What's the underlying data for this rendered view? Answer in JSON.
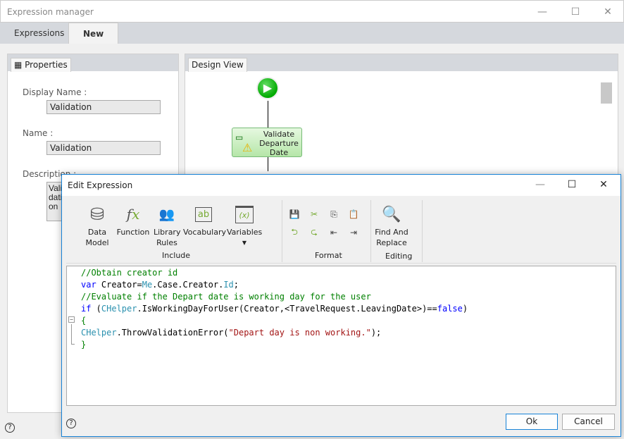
{
  "window": {
    "title": "Expression manager",
    "tabs": [
      "Expressions",
      "New"
    ],
    "active_tab": "New"
  },
  "properties": {
    "tab": "Properties",
    "display_name_label": "Display Name :",
    "display_name": "Validation",
    "name_label": "Name :",
    "name": "Validation",
    "description_label": "Description :",
    "description": "Validation"
  },
  "design": {
    "tab": "Design View",
    "task_label": "Validate Departure Date"
  },
  "dialog": {
    "title": "Edit Expression",
    "include": {
      "group": "Include",
      "buttons": [
        "Data Model",
        "Function",
        "Library Rules",
        "Vocabulary",
        "Variables"
      ]
    },
    "format": {
      "group": "Format"
    },
    "editing": {
      "group": "Editing",
      "buttons": [
        "Find And Replace"
      ]
    },
    "code": [
      [
        [
          "c",
          "//Obtain creator id"
        ]
      ],
      [
        [
          "k",
          "var"
        ],
        [
          "p",
          " Creator="
        ],
        [
          "t",
          "Me"
        ],
        [
          "p",
          ".Case.Creator."
        ],
        [
          "t",
          "Id"
        ],
        [
          "p",
          ";"
        ]
      ],
      [
        [
          "c",
          "//Evaluate if the Depart date is working day for the user"
        ]
      ],
      [
        [
          "k",
          "if"
        ],
        [
          "p",
          " ("
        ],
        [
          "t",
          "CHelper"
        ],
        [
          "p",
          ".IsWorkingDayForUser(Creator,<TravelRequest.LeavingDate>)=="
        ],
        [
          "k",
          "false"
        ],
        [
          "p",
          ")"
        ]
      ],
      [
        [
          "c",
          "{"
        ]
      ],
      [
        [
          "t",
          "CHelper"
        ],
        [
          "p",
          ".ThrowValidationError("
        ],
        [
          "s",
          "\"Depart day is non working.\""
        ],
        [
          "p",
          ");"
        ]
      ],
      [
        [
          "c",
          "}"
        ]
      ]
    ],
    "ok": "Ok",
    "cancel": "Cancel"
  },
  "colors": {
    "accent": "#1883d7",
    "comment": "#008000",
    "keyword": "#0000ff",
    "type": "#2b91af",
    "string": "#a31515"
  }
}
